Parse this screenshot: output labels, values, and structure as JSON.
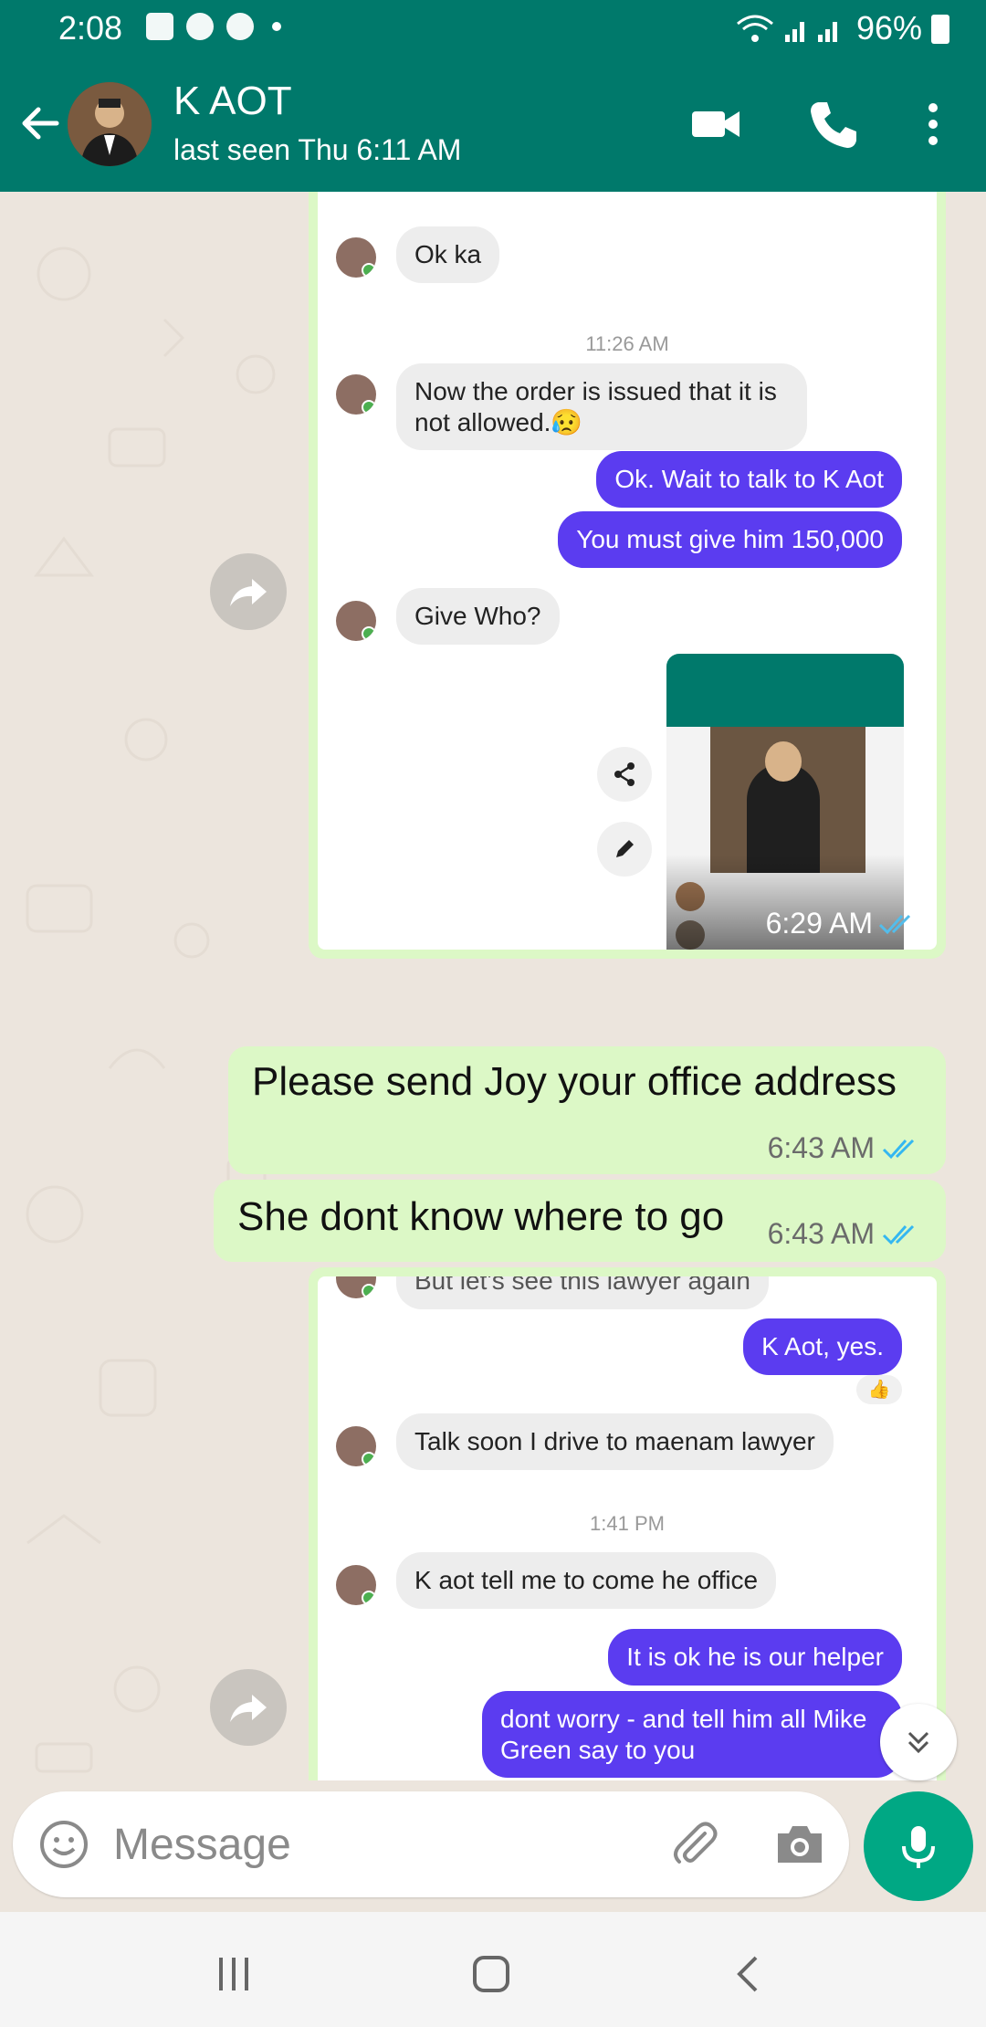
{
  "status_bar": {
    "time": "2:08",
    "battery": "96%"
  },
  "header": {
    "contact_name": "K AOT",
    "last_seen": "last seen Thu 6:11 AM"
  },
  "screenshot1": {
    "messages": [
      {
        "dir": "in",
        "text": "Ok ka"
      },
      {
        "dir": "time",
        "text": "11:26 AM"
      },
      {
        "dir": "in",
        "text": "Now the order is issued that it is not allowed.😥"
      },
      {
        "dir": "out",
        "text": "Ok. Wait to talk to K Aot"
      },
      {
        "dir": "out",
        "text": "You must give him 150,000"
      },
      {
        "dir": "in",
        "text": "Give Who?"
      }
    ],
    "timestamp": "6:29 AM"
  },
  "messages": [
    {
      "text": "Please send Joy your office address",
      "time": "6:43 AM"
    },
    {
      "text": "She dont know where to go",
      "time": "6:43 AM"
    }
  ],
  "screenshot2": {
    "partial_top": "But let's see this lawyer again",
    "messages": [
      {
        "dir": "out",
        "text": "K Aot, yes."
      },
      {
        "dir": "in",
        "text": "Talk soon I drive to maenam lawyer"
      },
      {
        "dir": "time",
        "text": "1:41 PM"
      },
      {
        "dir": "in",
        "text": "K aot tell me to come he office"
      },
      {
        "dir": "out",
        "text": "It is ok he is our helper"
      },
      {
        "dir": "out",
        "text": "dont worry - and tell him all Mike Green say to you"
      }
    ]
  },
  "input": {
    "placeholder": "Message"
  },
  "colors": {
    "header": "#00796B",
    "outgoing_bubble": "#DCF8C6",
    "mic_button": "#00A884",
    "purple_bubble": "#5b3cf0"
  }
}
